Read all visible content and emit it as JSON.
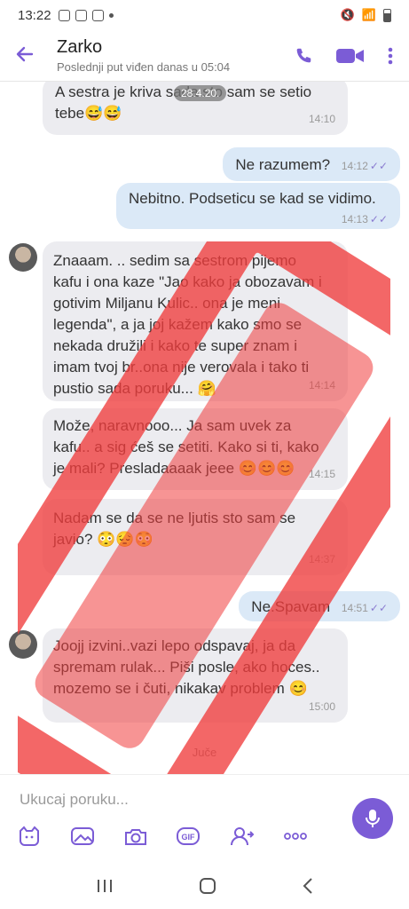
{
  "status": {
    "time": "13:22"
  },
  "header": {
    "contact_name": "Zarko",
    "last_seen": "Poslednji put viđen danas u 05:04"
  },
  "chat": {
    "date_chip": "28.4.20.",
    "messages": [
      {
        "dir": "in",
        "text": "A sestra je kriva sada sto sam se setio\ntebe",
        "emoji": "😅😅",
        "time": "14:10"
      },
      {
        "dir": "out",
        "text": "Ne razumem?",
        "time": "14:12"
      },
      {
        "dir": "out",
        "text": "Nebitno. Podseticu se kad se vidimo.",
        "time": "14:13"
      },
      {
        "dir": "in",
        "text": "Znaaam. .. sedim sa sestrom pijemo\nkafu i ona kaze \"Jao kako ja obozavam i\ngotivim Miljanu Kulic.. ona je meni\nlegenda\", a ja joj kažem kako smo se\nnekada družili i kako te super znam i\nimam tvoj br..ona nije verovala i tako ti\npustio sada poruku...",
        "emoji": "🤗",
        "time": "14:14"
      },
      {
        "dir": "in",
        "text": "Može, naravnooo... Ja sam uvek za\nkafu.. a sig ćeš se setiti.  Kako si ti, kako\nje mali? Presladaaaak jeee",
        "emoji": "😊😊😊",
        "time": "14:15"
      },
      {
        "dir": "in",
        "text": "Nadam se da se ne ljutis sto sam se\njavio?",
        "emoji": "😳😔😳",
        "time": "14:37"
      },
      {
        "dir": "out",
        "text": "Ne.Spavam",
        "time": "14:51"
      },
      {
        "dir": "in",
        "text": "Joojj izvini..vazi lepo odspavaj, ja da\nspremam rulak... Piši posle, ako hoces..\nmozemo se i čuti, nikakav problem",
        "emoji": "😊",
        "time": "15:00"
      }
    ],
    "day_separator": "Juče"
  },
  "composer": {
    "placeholder": "Ukucaj poruku...",
    "tools": [
      "sticker-icon",
      "image-icon",
      "camera-icon",
      "gif-icon",
      "share-contact-icon",
      "more-icon"
    ],
    "gif_label": "GIF"
  },
  "colors": {
    "accent": "#7b5cd6",
    "incoming": "#ececf0",
    "outgoing": "#dbe9f7",
    "watermark": "#f03c3c"
  }
}
